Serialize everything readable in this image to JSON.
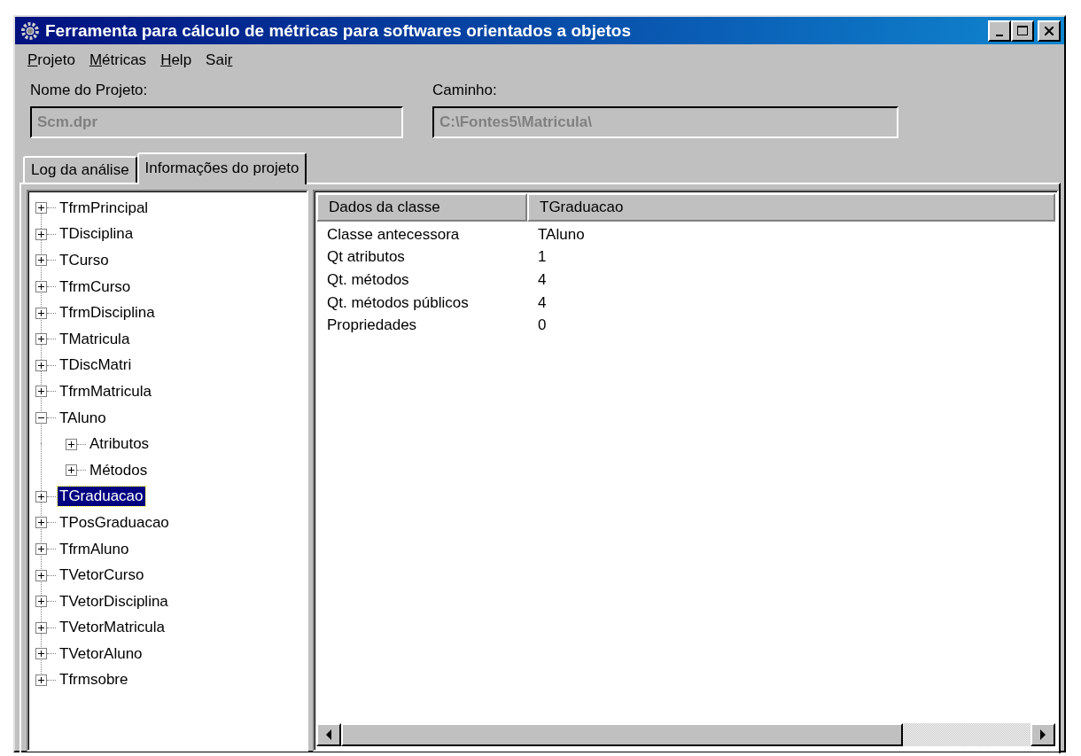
{
  "window": {
    "title": "Ferramenta para cálculo de métricas para softwares orientados a objetos"
  },
  "menu": [
    {
      "label": "Projeto",
      "mnemonic_at_end": false
    },
    {
      "label": "Métricas",
      "mnemonic_at_end": false
    },
    {
      "label": "Help",
      "mnemonic_at_end": false
    },
    {
      "label": "Sair",
      "mnemonic_at_end": true
    }
  ],
  "fields": [
    {
      "label": "Nome do Projeto:",
      "value": "Scm.dpr",
      "disabled": true
    },
    {
      "label": "Caminho:",
      "value": "C:\\Fontes5\\Matricula\\",
      "disabled": true
    }
  ],
  "tabs": [
    {
      "label": "Log da análise",
      "selected": false
    },
    {
      "label": "Informações do projeto",
      "selected": true
    }
  ],
  "tree": [
    {
      "label": "TfrmPrincipal",
      "expanded": false,
      "selected": false
    },
    {
      "label": "TDisciplina",
      "expanded": false,
      "selected": false
    },
    {
      "label": "TCurso",
      "expanded": false,
      "selected": false
    },
    {
      "label": "TfrmCurso",
      "expanded": false,
      "selected": false
    },
    {
      "label": "TfrmDisciplina",
      "expanded": false,
      "selected": false
    },
    {
      "label": "TMatricula",
      "expanded": false,
      "selected": false
    },
    {
      "label": "TDiscMatri",
      "expanded": false,
      "selected": false
    },
    {
      "label": "TfrmMatricula",
      "expanded": false,
      "selected": false
    },
    {
      "label": "TAluno",
      "expanded": true,
      "selected": false,
      "children": [
        {
          "label": "Atributos",
          "expanded": false,
          "selected": false
        },
        {
          "label": "Métodos",
          "expanded": false,
          "selected": false
        }
      ]
    },
    {
      "label": "TGraduacao",
      "expanded": false,
      "selected": true
    },
    {
      "label": "TPosGraduacao",
      "expanded": false,
      "selected": false
    },
    {
      "label": "TfrmAluno",
      "expanded": false,
      "selected": false
    },
    {
      "label": "TVetorCurso",
      "expanded": false,
      "selected": false
    },
    {
      "label": "TVetorDisciplina",
      "expanded": false,
      "selected": false
    },
    {
      "label": "TVetorMatricula",
      "expanded": false,
      "selected": false
    },
    {
      "label": "TVetorAluno",
      "expanded": false,
      "selected": false
    },
    {
      "label": "Tfrmsobre",
      "expanded": false,
      "selected": false
    }
  ],
  "table": {
    "columns": [
      "Dados da classe",
      "TGraduacao"
    ],
    "rows": [
      [
        "Classe antecessora",
        "TAluno"
      ],
      [
        "Qt atributos",
        "1"
      ],
      [
        "Qt. métodos",
        "4"
      ],
      [
        "Qt. métodos públicos",
        "4"
      ],
      [
        "Propriedades",
        "0"
      ]
    ]
  }
}
